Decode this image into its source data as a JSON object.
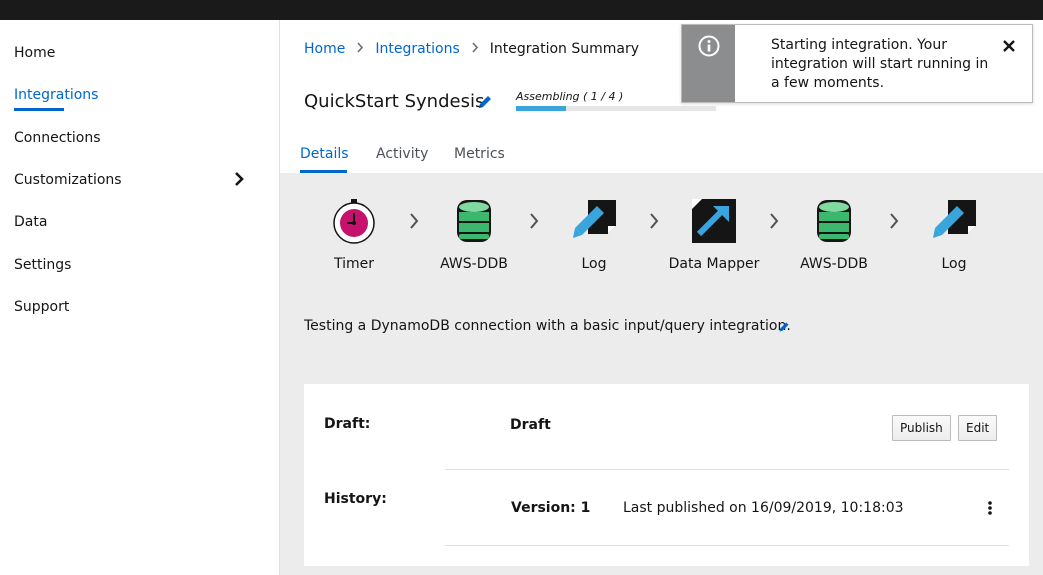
{
  "nav": {
    "items": [
      {
        "label": "Home",
        "name": "nav-item-home"
      },
      {
        "label": "Integrations",
        "name": "nav-item-integrations",
        "active": true
      },
      {
        "label": "Connections",
        "name": "nav-item-connections"
      },
      {
        "label": "Customizations",
        "name": "nav-item-customizations",
        "has_submenu": true
      },
      {
        "label": "Data",
        "name": "nav-item-data"
      },
      {
        "label": "Settings",
        "name": "nav-item-settings"
      },
      {
        "label": "Support",
        "name": "nav-item-support"
      }
    ]
  },
  "breadcrumb": {
    "home": "Home",
    "integrations": "Integrations",
    "current": "Integration Summary"
  },
  "integration": {
    "title": "QuickStart Syndesis",
    "status_label": "Assembling ( 1 / 4 )",
    "progress_fraction": 0.25,
    "description": "Testing a DynamoDB connection with a basic input/query integration."
  },
  "tabs": [
    {
      "label": "Details",
      "active": true
    },
    {
      "label": "Activity"
    },
    {
      "label": "Metrics"
    }
  ],
  "steps": [
    {
      "label": "Timer",
      "icon": "timer-icon"
    },
    {
      "label": "AWS-DDB",
      "icon": "aws-ddb-icon"
    },
    {
      "label": "Log",
      "icon": "log-icon"
    },
    {
      "label": "Data Mapper",
      "icon": "data-mapper-icon"
    },
    {
      "label": "AWS-DDB",
      "icon": "aws-ddb-icon"
    },
    {
      "label": "Log",
      "icon": "log-icon"
    }
  ],
  "details": {
    "draft_label": "Draft:",
    "draft_value": "Draft",
    "publish_button": "Publish",
    "edit_button": "Edit",
    "history_label": "History:",
    "version": "Version: 1",
    "last_published": "Last published on 16/09/2019, 10:18:03"
  },
  "toast": {
    "message": "Starting integration. Your integration will start running in a few moments.",
    "icon": "info-icon"
  },
  "colors": {
    "accent": "#0066cc",
    "progress": "#39a5dc",
    "toast_icon_bg": "#8b8d8f",
    "db_green": "#3bb76e",
    "timer_magenta": "#c4126d"
  }
}
